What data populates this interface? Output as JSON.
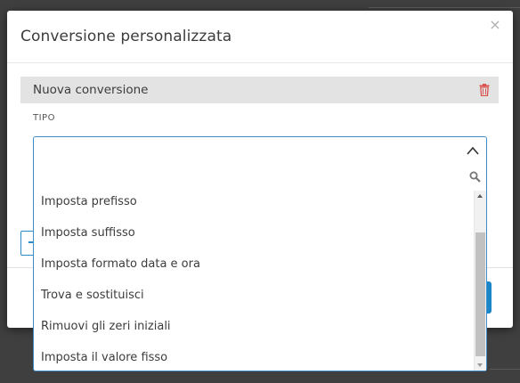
{
  "dialog": {
    "title": "Conversione personalizzata",
    "close_glyph": "×"
  },
  "section": {
    "title": "Nuova conversione"
  },
  "field": {
    "label": "TIPO",
    "value": ""
  },
  "dropdown": {
    "options": [
      "Imposta prefisso",
      "Imposta suffisso",
      "Imposta formato data e ora",
      "Trova e sostituisci",
      "Rimuovi gli zeri iniziali",
      "Imposta il valore fisso"
    ]
  },
  "colors": {
    "accent": "#3c8dc9",
    "danger": "#d9534f",
    "section_bg": "#e3e3e3"
  },
  "icons": [
    "close-icon",
    "trash-icon",
    "chevron-up-icon",
    "search-icon"
  ]
}
